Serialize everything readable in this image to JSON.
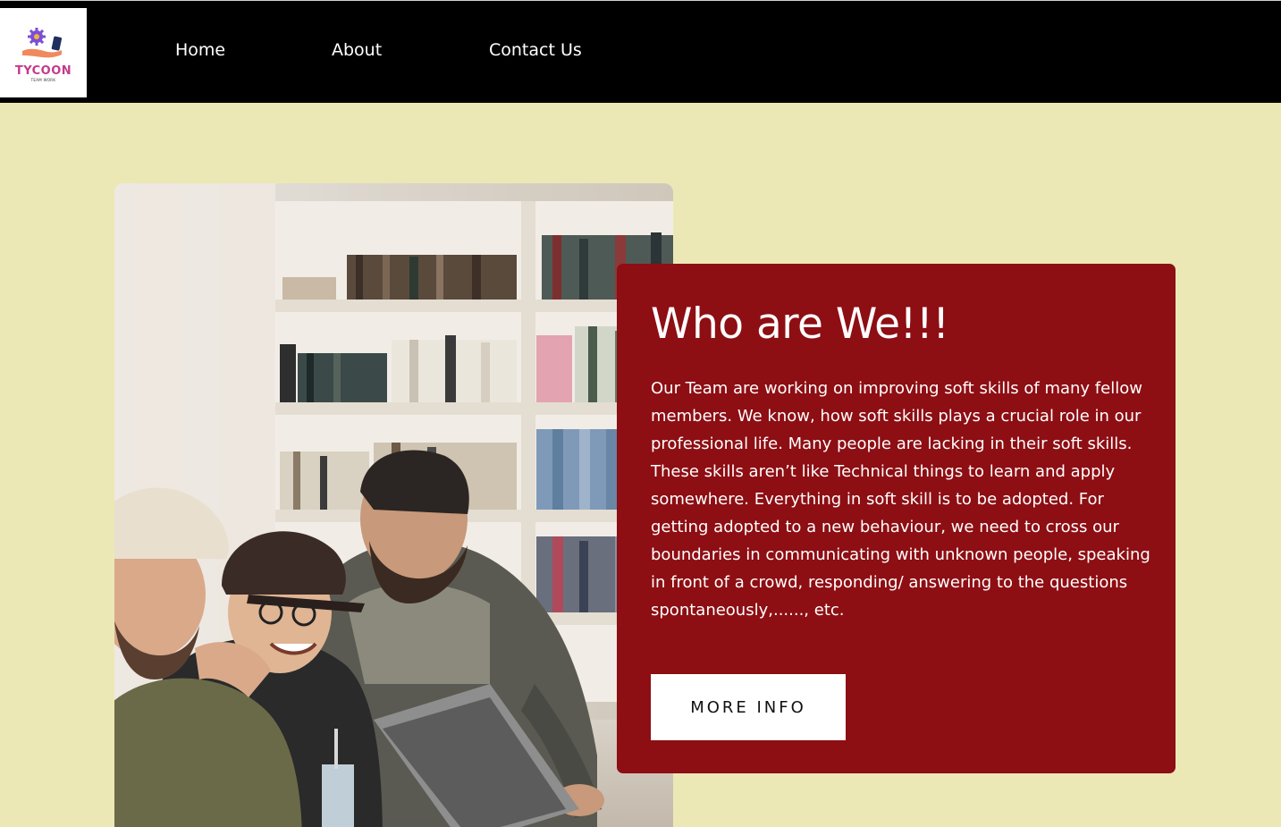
{
  "brand": {
    "logo_text": "TYCOON",
    "logo_subtext": "TEAM WORK"
  },
  "nav": {
    "items": [
      {
        "label": "Home"
      },
      {
        "label": "About"
      },
      {
        "label": "Contact Us"
      }
    ]
  },
  "hero": {
    "image_icon": "team-photo"
  },
  "about_card": {
    "title": "Who are We!!!",
    "body": "Our Team are working on improving soft skills of many fellow members. We know, how soft skills plays a crucial role in our professional life. Many people are lacking in their soft skills. These skills aren’t like Technical things to learn and apply somewhere. Everything in soft skill is to be adopted. For getting adopted to a new behaviour, we need to cross our boundaries in communicating with unknown people, speaking in front of a crowd, responding/ answering to the questions spontaneously,......, etc.",
    "button_label": "MORE INFO"
  },
  "colors": {
    "nav_background": "#000000",
    "page_background": "#ebe8b6",
    "card_background": "#8d0e13",
    "button_background": "#ffffff",
    "logo_accent": "#c43a8c"
  }
}
